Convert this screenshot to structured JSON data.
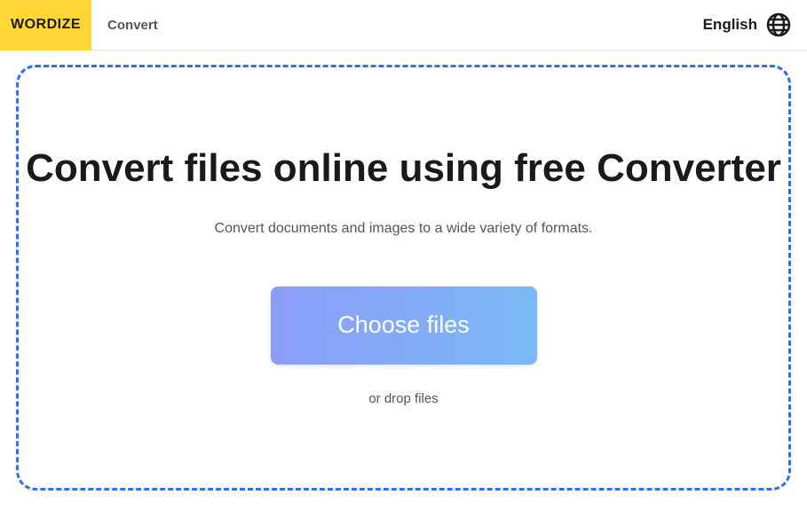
{
  "header": {
    "logo": "WORDIZE",
    "nav_convert": "Convert",
    "language": "English"
  },
  "main": {
    "heading": "Convert files online using free Converter",
    "subtext": "Convert documents and images to a wide variety of formats.",
    "choose_button": "Choose files",
    "drop_text": "or drop files"
  }
}
